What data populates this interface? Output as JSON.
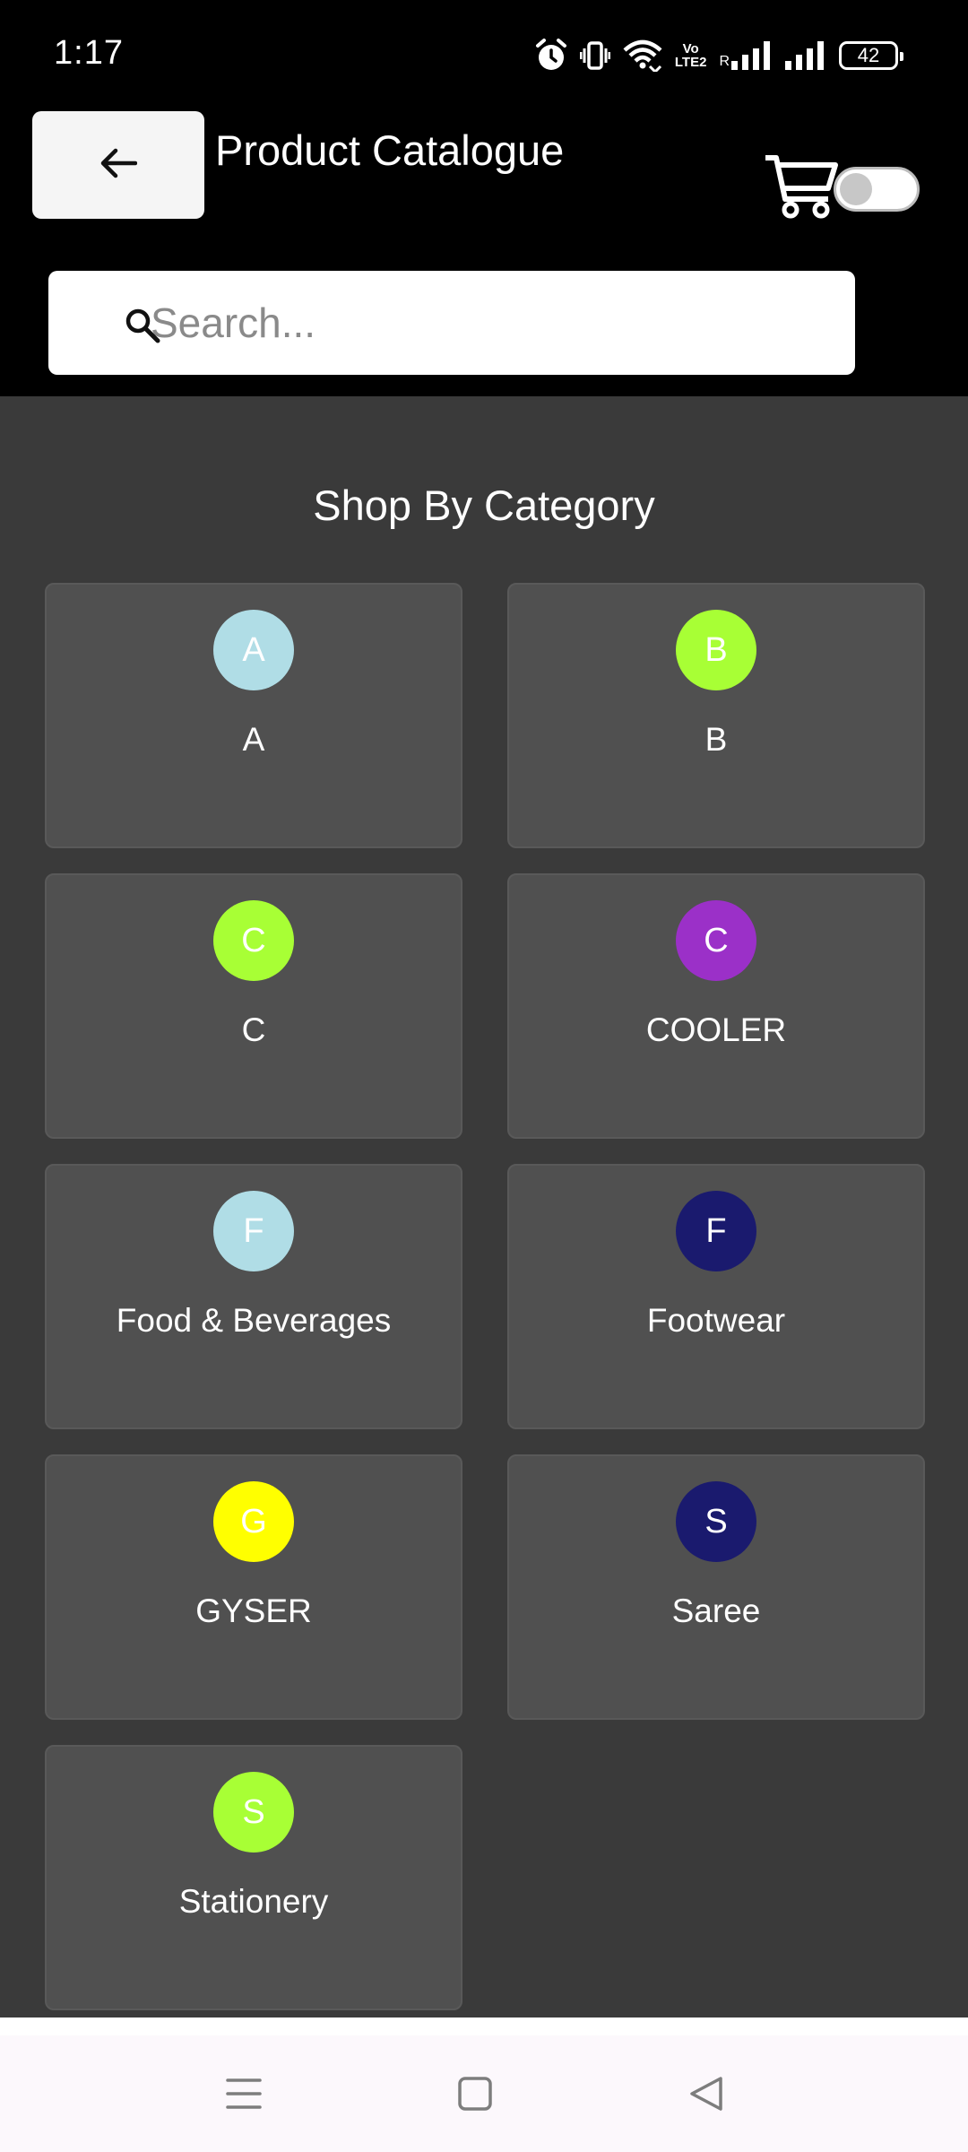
{
  "status_bar": {
    "time": "1:17",
    "volte_top": "Vo",
    "volte_bottom": "LTE2",
    "roaming": "R",
    "battery": "42"
  },
  "header": {
    "title": "Product Catalogue",
    "back_icon": "arrow-left-icon",
    "cart_icon": "shopping-cart-icon"
  },
  "search": {
    "placeholder": "Search...",
    "value": ""
  },
  "main": {
    "section_title": "Shop By Category",
    "categories": [
      {
        "initial": "A",
        "label": "A",
        "color": "#b0dde6",
        "text_color": "#ffffff"
      },
      {
        "initial": "B",
        "label": "B",
        "color": "#a8ff35",
        "text_color": "#ffffff"
      },
      {
        "initial": "C",
        "label": "C",
        "color": "#a8ff35",
        "text_color": "#ffffff"
      },
      {
        "initial": "C",
        "label": "COOLER",
        "color": "#9b30c8",
        "text_color": "#ffffff"
      },
      {
        "initial": "F",
        "label": "Food & Beverages",
        "color": "#b0dde6",
        "text_color": "#ffffff"
      },
      {
        "initial": "F",
        "label": "Footwear",
        "color": "#1a1a6e",
        "text_color": "#ffffff"
      },
      {
        "initial": "G",
        "label": "GYSER",
        "color": "#ffff00",
        "text_color": "#ffffff"
      },
      {
        "initial": "S",
        "label": "Saree",
        "color": "#1a1a6e",
        "text_color": "#ffffff"
      },
      {
        "initial": "S",
        "label": "Stationery",
        "color": "#a8ff35",
        "text_color": "#ffffff"
      }
    ]
  },
  "nav_bar": {
    "menu_icon": "menu-icon",
    "home_icon": "home-square-icon",
    "back_icon": "back-triangle-icon"
  }
}
